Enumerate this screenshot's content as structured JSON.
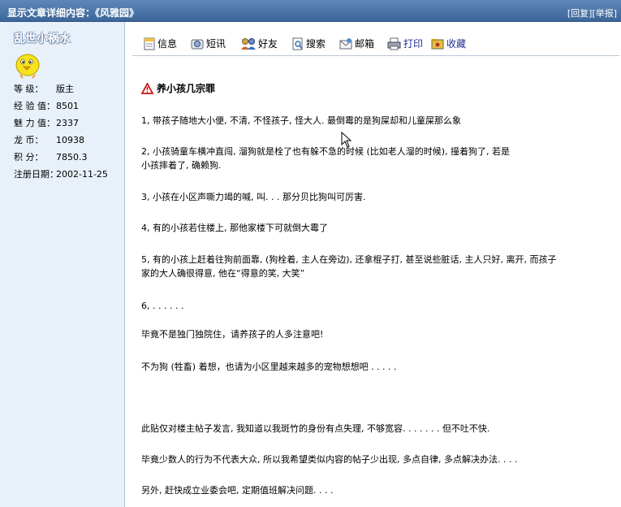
{
  "header": {
    "title": "显示文章详细内容：《风雅园》",
    "reply_label": "[回复]",
    "report_label": "[举报]"
  },
  "sidebar": {
    "username": "乱世小祸水",
    "avatar_icon": "yellow-chick-icon",
    "fields": [
      {
        "label": "等    级：",
        "value": "版主"
      },
      {
        "label": "经 验 值：",
        "value": "8501"
      },
      {
        "label": "魅 力 值：",
        "value": "2337"
      },
      {
        "label": "龙    币：",
        "value": "10938"
      },
      {
        "label": "积    分：",
        "value": "7850.3"
      },
      {
        "label": "注册日期：",
        "value": "2002-11-25"
      }
    ]
  },
  "toolbar": {
    "items": [
      {
        "label": "信息",
        "icon": "info-icon"
      },
      {
        "label": "短讯",
        "icon": "message-icon"
      },
      {
        "label": "好友",
        "icon": "friends-icon"
      },
      {
        "label": "搜索",
        "icon": "search-icon"
      },
      {
        "label": "邮箱",
        "icon": "mailbox-icon"
      },
      {
        "label": "打印",
        "icon": "print-icon"
      },
      {
        "label": "收藏",
        "icon": "favorite-icon"
      }
    ]
  },
  "article": {
    "title": "养小孩几宗罪",
    "paragraphs": [
      "1, 带孩子随地大小便, 不清, 不怪孩子, 怪大人. 最倒霉的是狗屎却和儿童屎那么象",
      "2, 小孩骑童车横冲直闯, 溜狗就是栓了也有躲不急的时候 (比如老人溜的时候), 撞着狗了, 若是",
      "小孩摔着了, 确赖狗.",
      "3, 小孩在小区声嘶力竭的喊, 叫. . . 那分贝比狗叫可厉害.",
      "4, 有的小孩若住楼上, 那他家楼下可就倒大霉了",
      "5, 有的小孩上赶着往狗前面靠, (狗栓着, 主人在旁边), 还拿棍子打, 甚至说些脏话, 主人只好, 离开, 而孩子",
      "家的大人确很得意, 他在“得意的笑, 大笑”",
      "6, . . . . . .",
      "毕竟不是独门独院住，请养孩子的人多注意吧!",
      "不为狗 (牲畜) 着想，也请为小区里越来越多的宠物想想吧 . . . . .",
      "此贴仅对楼主帖子发言, 我知道以我斑竹的身份有点失理, 不够宽容. . . . . . . 但不吐不快.",
      "毕竟少数人的行为不代表大众, 所以我希望类似内容的帖子少出现, 多点自律, 多点解决办法. . . .",
      "另外, 赶快成立业委会吧, 定期值班解决问题. . . ."
    ]
  }
}
